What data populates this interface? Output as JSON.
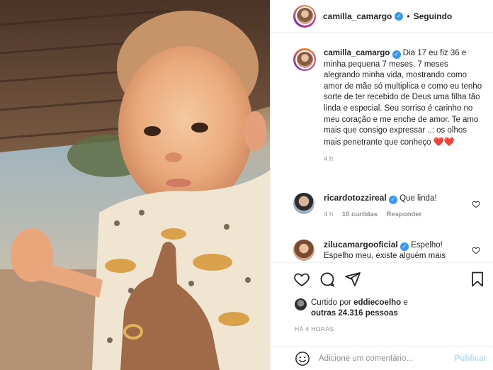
{
  "post": {
    "author": "camilla_camargo",
    "follow_separator": "•",
    "follow_status": "Seguindo"
  },
  "caption": {
    "author": "camilla_camargo",
    "text": "Dia 17 eu fiz 36 e minha pequena 7 meses. 7 meses alegrando minha vida, mostrando como amor de mãe só multiplica e como eu tenho sorte de ter recebido de Deus uma filha tão linda e especial. Seu sorriso é carinho no meu coração e me enche de amor. Te amo mais que consigo expressar ..: os olhos mais penetrante que conheço",
    "hearts": "❤️❤️",
    "time": "4 h"
  },
  "comments": [
    {
      "author": "ricardotozzireal",
      "text": "Que linda!",
      "time": "4 h",
      "likes": "10 curtidas",
      "reply": "Responder"
    },
    {
      "author": "zilucamargooficial",
      "text_line1": "Espelho!",
      "text_line2": "Espelho meu, existe alguém mais"
    }
  ],
  "likes": {
    "prefix": "Curtido por",
    "user": "eddiecoelho",
    "connector": "e",
    "others": "outras 24.316 pessoas"
  },
  "date": "HÁ 4 HORAS",
  "add_comment": {
    "placeholder": "Adicione um comentário...",
    "publish_label": "Publicar"
  },
  "icons": {
    "verified": "verified-badge-icon",
    "like": "heart-icon",
    "comment": "comment-icon",
    "share": "share-icon",
    "save": "bookmark-icon",
    "emoji": "emoji-icon"
  },
  "colors": {
    "verified": "#3897f0",
    "heart": "#e0245e",
    "publish_disabled": "#b2dffc",
    "muted_text": "#8e8e8e"
  }
}
